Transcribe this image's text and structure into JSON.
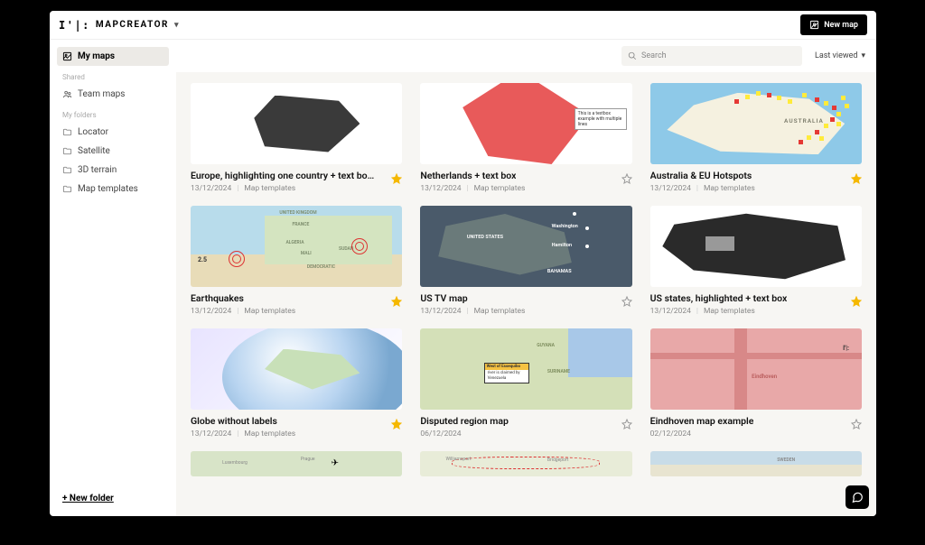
{
  "brand": "MAPCREATOR",
  "new_map_btn": "New map",
  "sidebar": {
    "my_maps": "My maps",
    "shared_label": "Shared",
    "team_maps": "Team maps",
    "folders_label": "My folders",
    "folders": [
      {
        "label": "Locator"
      },
      {
        "label": "Satellite"
      },
      {
        "label": "3D terrain"
      },
      {
        "label": "Map templates"
      }
    ],
    "new_folder": "+ New folder"
  },
  "search_placeholder": "Search",
  "sort_label": "Last viewed",
  "cards": [
    {
      "title": "Europe, highlighting one country + text bo…",
      "date": "13/12/2024",
      "folder": "Map templates",
      "starred": true,
      "thumb": "europe"
    },
    {
      "title": "Netherlands + text box",
      "date": "13/12/2024",
      "folder": "Map templates",
      "starred": false,
      "thumb": "nl",
      "textbox": "This is a textbox example with multiple lines"
    },
    {
      "title": "Australia & EU Hotspots",
      "date": "13/12/2024",
      "folder": "Map templates",
      "starred": true,
      "thumb": "aus",
      "label": "AUSTRALIA"
    },
    {
      "title": "Earthquakes",
      "date": "13/12/2024",
      "folder": "Map templates",
      "starred": true,
      "thumb": "eq",
      "mag": "2.5",
      "labs": [
        "UNITED KINGDOM",
        "FRANCE",
        "ALGERIA",
        "MALI",
        "SUDAN",
        "DEMOCRATIC"
      ]
    },
    {
      "title": "US TV map",
      "date": "13/12/2024",
      "folder": "Map templates",
      "starred": false,
      "thumb": "ustv",
      "labs": [
        "UNITED STATES",
        "Washington",
        "Hamilton",
        "BAHAMAS"
      ]
    },
    {
      "title": "US states, highlighted + text box",
      "date": "13/12/2024",
      "folder": "Map templates",
      "starred": true,
      "thumb": "usst"
    },
    {
      "title": "Globe without labels",
      "date": "13/12/2024",
      "folder": "Map templates",
      "starred": true,
      "thumb": "globe"
    },
    {
      "title": "Disputed region map",
      "date": "06/12/2024",
      "folder": "",
      "starred": false,
      "thumb": "disp",
      "box_hdr": "West of Essequibo",
      "box_txt": "river is claimed by Venezuela",
      "labs": [
        "GUYANA",
        "SURINAME"
      ]
    },
    {
      "title": "Eindhoven map example",
      "date": "02/12/2024",
      "folder": "",
      "starred": false,
      "thumb": "eind",
      "lab": "Eindhoven",
      "logo": "I'|:"
    },
    {
      "title": "",
      "date": "",
      "folder": "",
      "starred": false,
      "thumb": "p1",
      "partial": true,
      "labs": [
        "Luxembourg",
        "Prague"
      ]
    },
    {
      "title": "",
      "date": "",
      "folder": "",
      "starred": false,
      "thumb": "p2",
      "partial": true,
      "labs": [
        "Williamsport",
        "Bridgeport"
      ]
    },
    {
      "title": "",
      "date": "",
      "folder": "",
      "starred": false,
      "thumb": "p3",
      "partial": true,
      "labs": [
        "SWEDEN"
      ]
    }
  ]
}
